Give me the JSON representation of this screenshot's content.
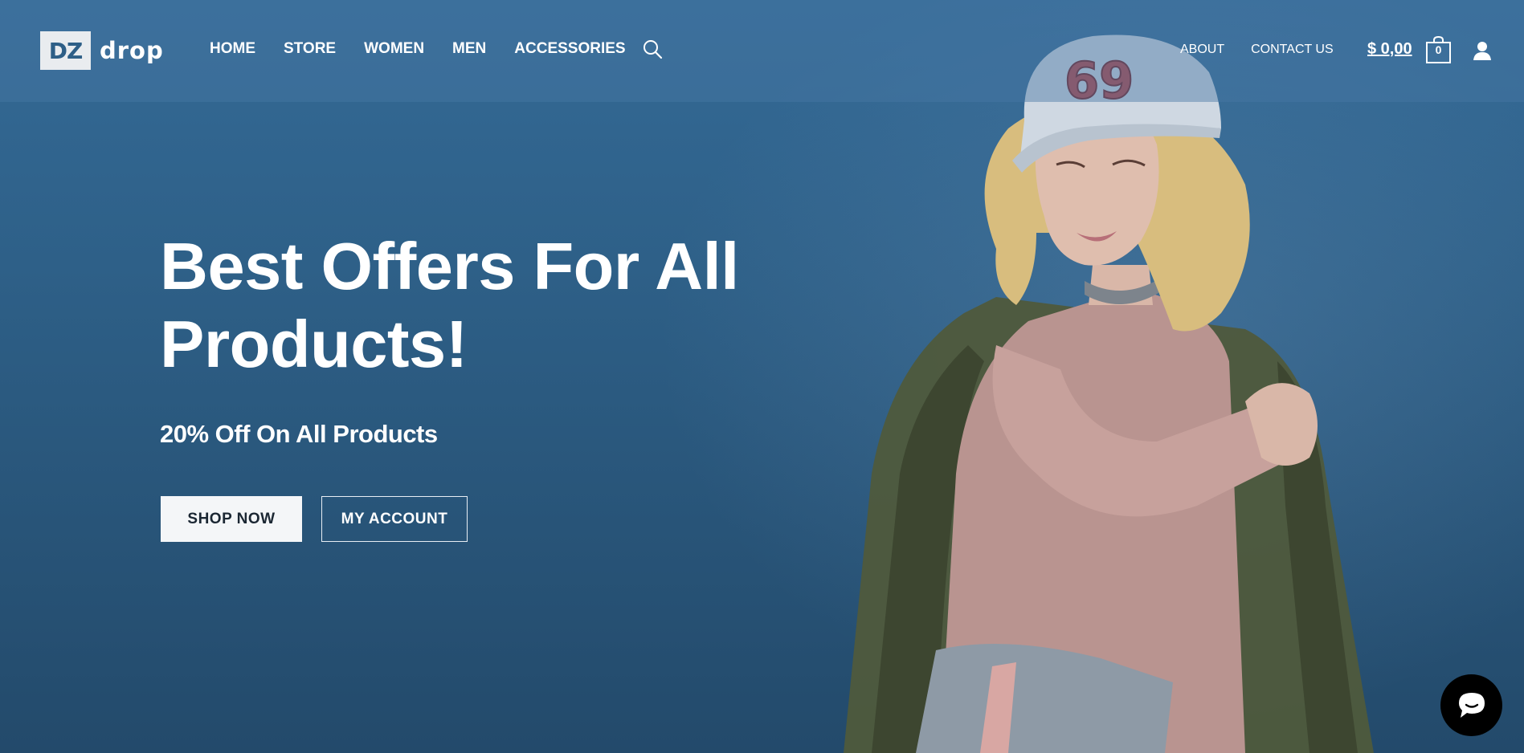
{
  "brand": {
    "logo_box": "DZ",
    "logo_text": "drop"
  },
  "nav": {
    "items": [
      "HOME",
      "STORE",
      "WOMEN",
      "MEN",
      "ACCESSORIES"
    ],
    "search_icon": "search-icon"
  },
  "secondary_nav": {
    "items": [
      "ABOUT",
      "CONTACT US"
    ]
  },
  "cart": {
    "total": "$ 0,00",
    "count": "0",
    "icon": "shopping-bag-icon"
  },
  "account": {
    "icon": "user-icon"
  },
  "hero": {
    "title": "Best Offers For All Products!",
    "subtitle": "20% Off On All Products",
    "primary_button": "SHOP NOW",
    "secondary_button": "MY ACCOUNT",
    "cap_text": "69"
  },
  "chat": {
    "icon": "chat-bubble-icon"
  },
  "colors": {
    "hero_background": "#2c5a82",
    "header_overlay": "#4678a5",
    "button_light": "#f4f6f8",
    "chat_bubble": "#000000"
  }
}
